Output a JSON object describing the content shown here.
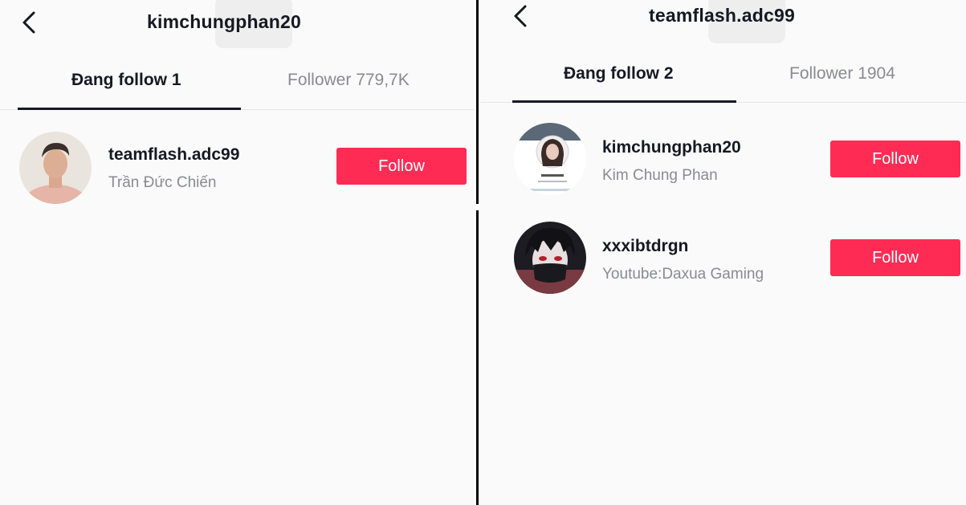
{
  "accent_color": "#fe2c55",
  "left_panel": {
    "title": "kimchungphan20",
    "back_icon": "chevron-left-icon",
    "tabs": [
      {
        "label": "Đang follow 1",
        "active": true
      },
      {
        "label": "Follower 779,7K",
        "active": false
      }
    ],
    "users": [
      {
        "username": "teamflash.adc99",
        "display_name": "Trần Đức Chiến",
        "button_label": "Follow"
      }
    ]
  },
  "right_panel": {
    "title": "teamflash.adc99",
    "back_icon": "chevron-left-icon",
    "tabs": [
      {
        "label": "Đang follow 2",
        "active": true
      },
      {
        "label": "Follower 1904",
        "active": false
      }
    ],
    "users": [
      {
        "username": "kimchungphan20",
        "display_name": "Kim Chung Phan",
        "button_label": "Follow"
      },
      {
        "username": "xxxibtdrgn",
        "display_name": "Youtube:Daxua Gaming",
        "button_label": "Follow"
      }
    ]
  }
}
